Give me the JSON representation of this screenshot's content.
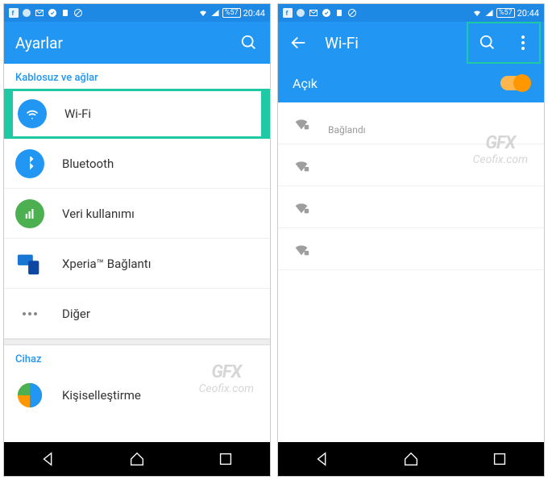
{
  "statusbar": {
    "battery": "%57",
    "time": "20:44"
  },
  "left": {
    "appbar_title": "Ayarlar",
    "section_wireless": "Kablosuz ve ağlar",
    "items": {
      "wifi": "Wi-Fi",
      "bluetooth": "Bluetooth",
      "data": "Veri kullanımı",
      "xperia": "Xperia™ Bağlantı",
      "more": "Diğer"
    },
    "section_device": "Cihaz",
    "personalization": "Kişiselleştirme"
  },
  "right": {
    "appbar_title": "Wi-Fi",
    "switch_label": "Açık",
    "connected": "Bağlandı"
  },
  "watermark": {
    "logo": "GFX",
    "site": "Ceofix.com"
  }
}
